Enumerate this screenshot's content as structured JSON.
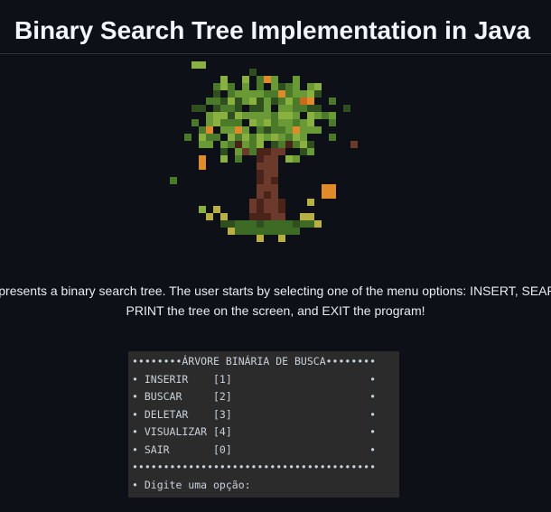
{
  "page": {
    "title": "Binary Search Tree Implementation in Java",
    "description": "m represents a binary search tree. The user starts by selecting one of the menu options: INSERT, SEARCH, PRINT the tree on the screen, and EXIT the program!"
  },
  "tree_image": {
    "icon": "pixel-tree-icon",
    "colors": {
      "leaf_dark": "#2f4f1f",
      "leaf_mid": "#4a7a2a",
      "leaf_light": "#6a9a35",
      "leaf_bright": "#8ab040",
      "fruit": "#e08a2a",
      "fruit_dark": "#c86a1a",
      "trunk": "#6b3a2a",
      "trunk_dark": "#4a2418",
      "grass_yellow": "#b8b040",
      "grass_green": "#3d6a25"
    }
  },
  "terminal": {
    "lines": [
      "••••••••ÁRVORE BINÁRIA DE BUSCA••••••••",
      "• INSERIR    [1]                      •",
      "• BUSCAR     [2]                      •",
      "• DELETAR    [3]                      •",
      "• VISUALIZAR [4]                      •",
      "• SAIR       [0]                      •",
      "•••••••••••••••••••••••••••••••••••••••",
      "• Digite uma opção:"
    ]
  }
}
